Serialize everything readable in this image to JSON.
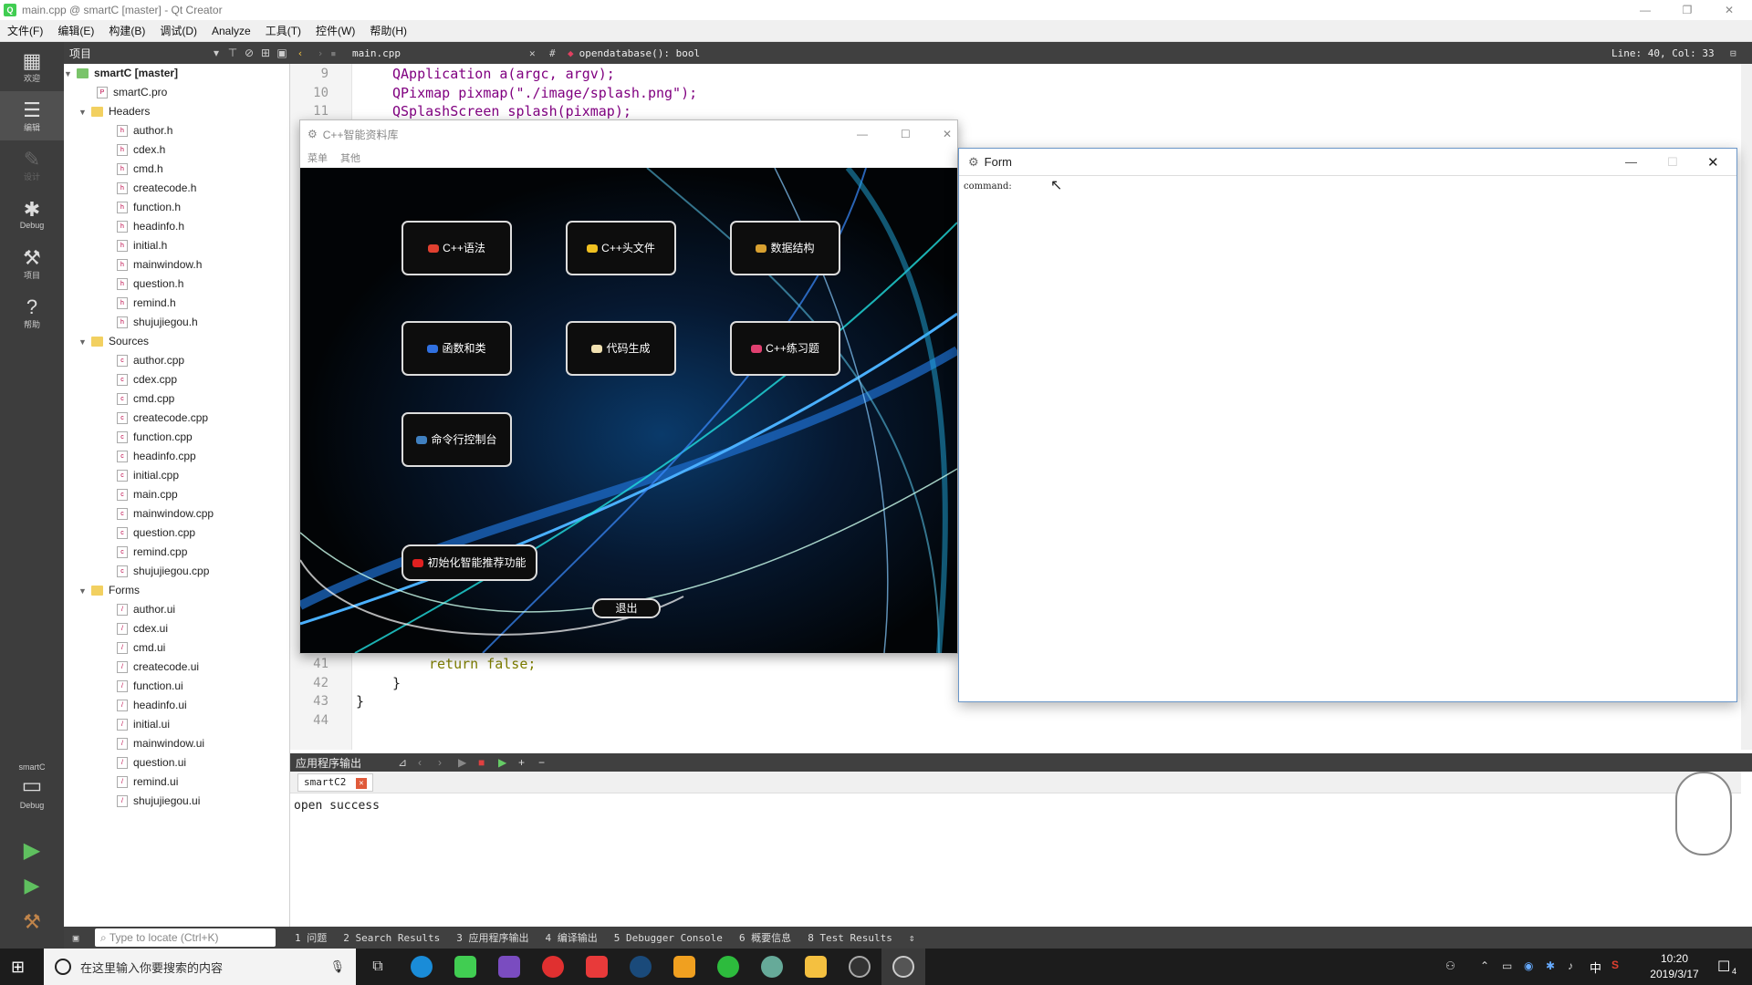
{
  "window": {
    "title": "main.cpp @ smartC [master] - Qt Creator",
    "app_icon": "qt-icon"
  },
  "menu": [
    "文件(F)",
    "编辑(E)",
    "构建(B)",
    "调试(D)",
    "Analyze",
    "工具(T)",
    "控件(W)",
    "帮助(H)"
  ],
  "modes": [
    {
      "label": "欢迎",
      "icon": "grid-icon"
    },
    {
      "label": "编辑",
      "icon": "edit-icon"
    },
    {
      "label": "设计",
      "icon": "pen-icon"
    },
    {
      "label": "Debug",
      "icon": "bug-icon"
    },
    {
      "label": "项目",
      "icon": "wrench-icon"
    },
    {
      "label": "帮助",
      "icon": "help-icon"
    }
  ],
  "kit": {
    "project": "smartC",
    "mode": "Debug"
  },
  "project_panel": {
    "selector": "项目"
  },
  "tree": {
    "root": "smartC [master]",
    "pro": "smartC.pro",
    "headers_label": "Headers",
    "headers": [
      "author.h",
      "cdex.h",
      "cmd.h",
      "createcode.h",
      "function.h",
      "headinfo.h",
      "initial.h",
      "mainwindow.h",
      "question.h",
      "remind.h",
      "shujujiegou.h"
    ],
    "sources_label": "Sources",
    "sources": [
      "author.cpp",
      "cdex.cpp",
      "cmd.cpp",
      "createcode.cpp",
      "function.cpp",
      "headinfo.cpp",
      "initial.cpp",
      "main.cpp",
      "mainwindow.cpp",
      "question.cpp",
      "remind.cpp",
      "shujujiegou.cpp"
    ],
    "forms_label": "Forms",
    "forms": [
      "author.ui",
      "cdex.ui",
      "cmd.ui",
      "createcode.ui",
      "function.ui",
      "headinfo.ui",
      "initial.ui",
      "mainwindow.ui",
      "question.ui",
      "remind.ui",
      "shujujiegou.ui"
    ]
  },
  "editor": {
    "file": "main.cpp",
    "symbol_hash": "#",
    "symbol": "opendatabase(): bool",
    "position": "Line: 40, Col: 33",
    "top_lines": [
      {
        "n": "9",
        "code": "QApplication a(argc, argv);"
      },
      {
        "n": "10",
        "code": "QPixmap pixmap(\"./image/splash.png\");"
      },
      {
        "n": "11",
        "code": "QSplashScreen splash(pixmap);"
      }
    ],
    "bottom_lines": [
      {
        "n": "41",
        "code": "return false;"
      },
      {
        "n": "42",
        "code": "}"
      },
      {
        "n": "43",
        "code": "}"
      },
      {
        "n": "44",
        "code": ""
      }
    ]
  },
  "output": {
    "panel_title": "应用程序输出",
    "tab": "smartC2",
    "text": "open success"
  },
  "status": {
    "locate_placeholder": "Type to locate (Ctrl+K)",
    "panes": [
      "1 问题",
      "2 Search Results",
      "3 应用程序输出",
      "4 编译输出",
      "5 Debugger Console",
      "6 概要信息",
      "8 Test Results"
    ]
  },
  "app_window": {
    "title": "C++智能资料库",
    "menu": [
      "菜单",
      "其他"
    ],
    "buttons": [
      "C++语法",
      "C++头文件",
      "数据结构",
      "函数和类",
      "代码生成",
      "C++练习题",
      "命令行控制台"
    ],
    "recommend": "初始化智能推荐功能",
    "exit": "退出"
  },
  "form_window": {
    "title": "Form",
    "label": "command:"
  },
  "taskbar": {
    "search": "在这里输入你要搜索的内容",
    "time": "10:20",
    "date": "2019/3/17",
    "ime": "中",
    "notify_count": "4"
  }
}
